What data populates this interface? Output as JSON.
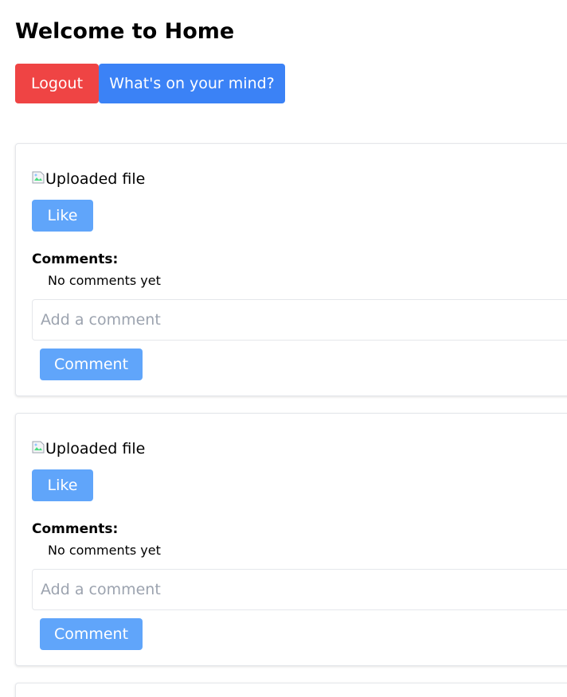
{
  "header": {
    "title": "Welcome to Home",
    "logout_label": "Logout",
    "whats_on_mind_label": "What's on your mind?"
  },
  "colors": {
    "logout": "#ef4444",
    "primary": "#3b82f6",
    "light_primary": "#60a5fa",
    "border": "#e5e7eb",
    "placeholder": "#9ca3af"
  },
  "posts": [
    {
      "image_alt": "Uploaded file",
      "like_label": "Like",
      "comments_heading": "Comments:",
      "comments_empty": "No comments yet",
      "comment_placeholder": "Add a comment",
      "comment_button": "Comment"
    },
    {
      "image_alt": "Uploaded file",
      "like_label": "Like",
      "comments_heading": "Comments:",
      "comments_empty": "No comments yet",
      "comment_placeholder": "Add a comment",
      "comment_button": "Comment"
    }
  ]
}
